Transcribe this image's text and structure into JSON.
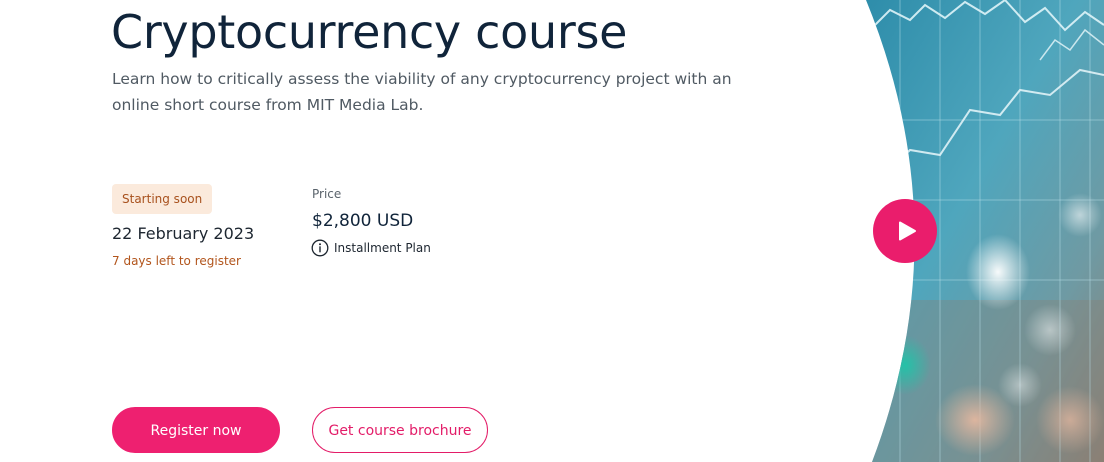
{
  "course": {
    "title": "Cryptocurrency course",
    "description": "Learn how to critically assess the viability of any cryptocurrency project with an online short course from MIT Media Lab."
  },
  "schedule": {
    "badge": "Starting soon",
    "start_date": "22 February 2023",
    "deadline": "7 days left to register"
  },
  "pricing": {
    "label": "Price",
    "value": "$2,800 USD",
    "installment_label": "Installment Plan",
    "installment_icon": "info-icon"
  },
  "actions": {
    "register_label": "Register now",
    "brochure_label": "Get course brochure"
  },
  "media": {
    "play_icon": "play-icon"
  },
  "colors": {
    "accent": "#ee2070",
    "title": "#10243a",
    "badge_bg": "#fbeadc",
    "badge_text": "#a8511d",
    "deadline": "#b2551c"
  }
}
